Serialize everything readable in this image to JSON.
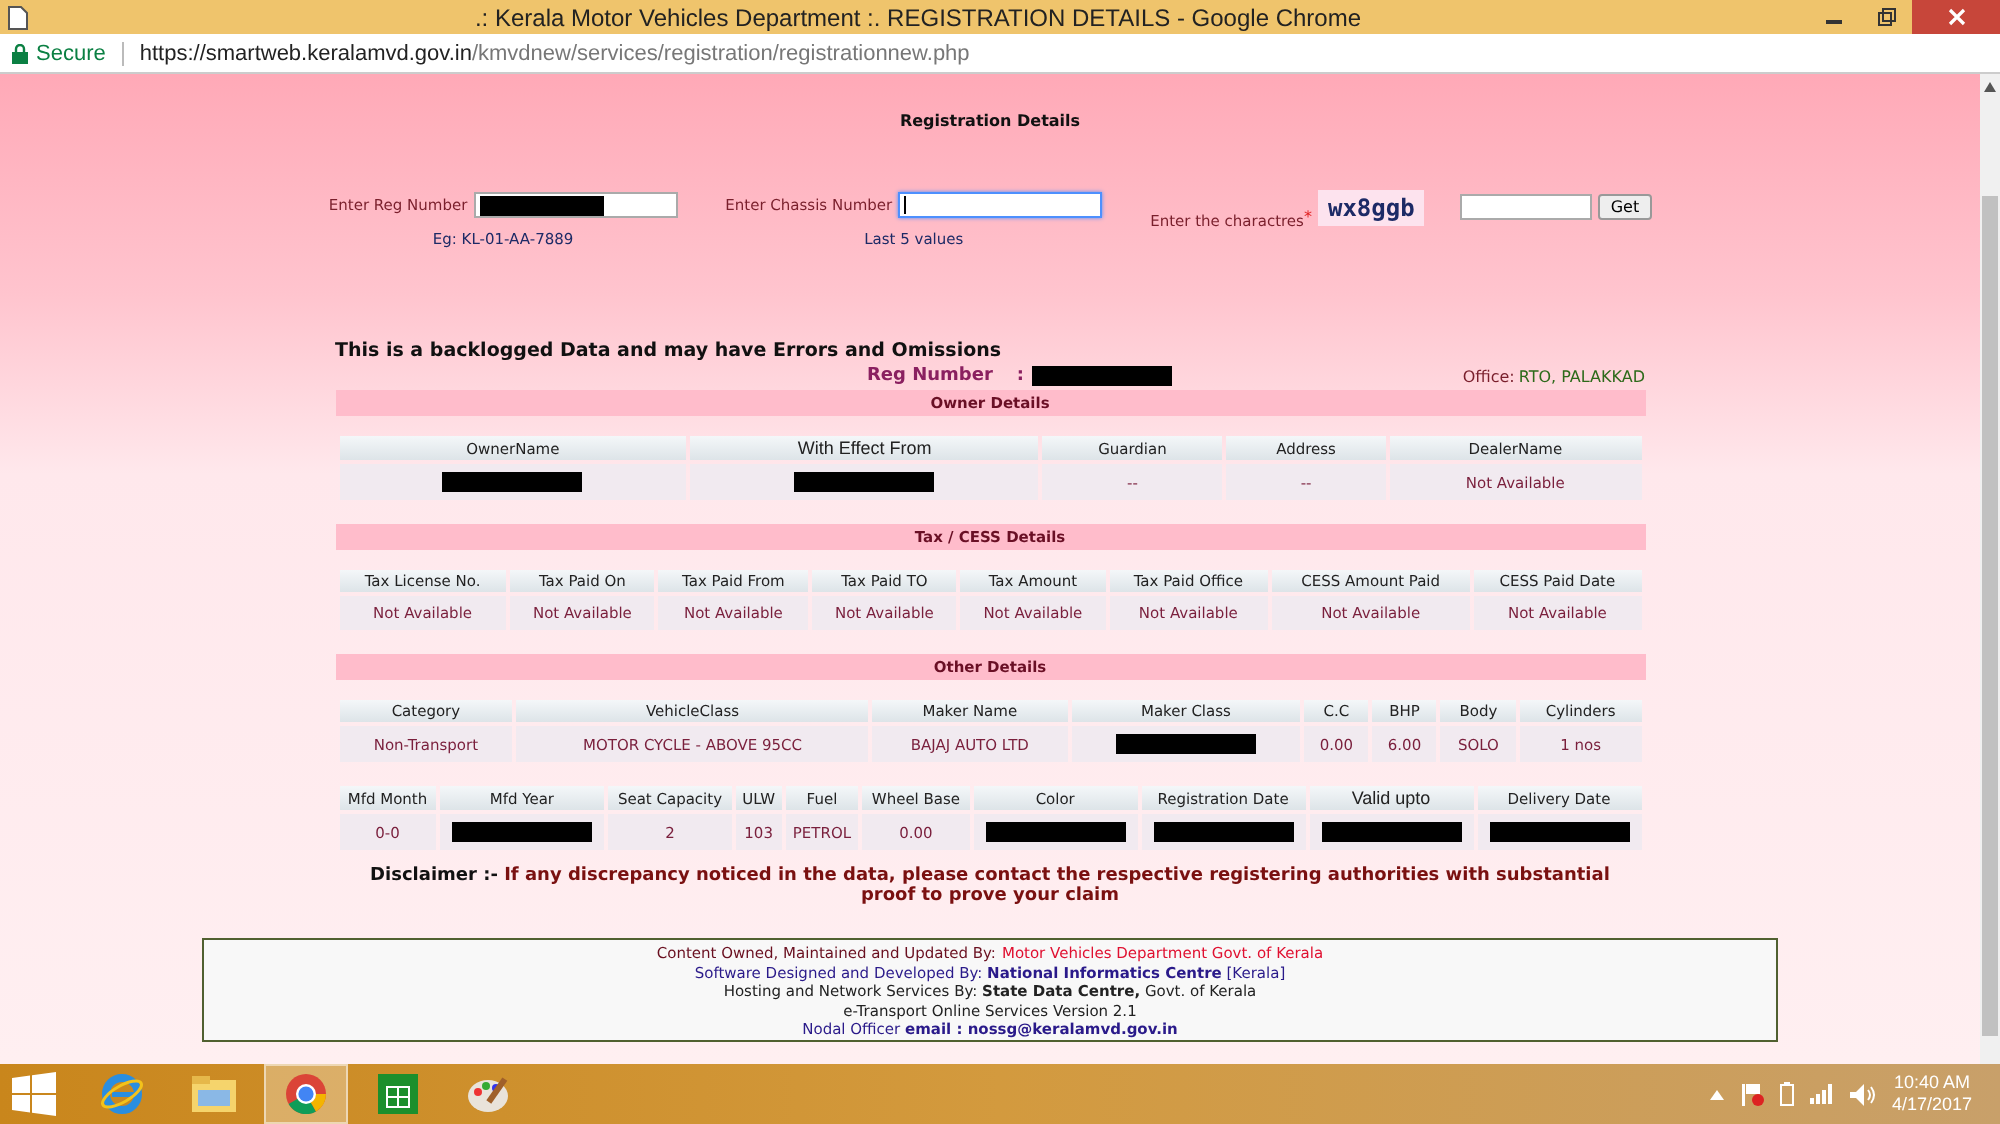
{
  "window": {
    "title": ".: Kerala Motor Vehicles Department :. REGISTRATION DETAILS - Google Chrome"
  },
  "address_bar": {
    "security": "Secure",
    "url_host": "https://smartweb.keralamvd.gov.in",
    "url_path": "/kmvdnew/services/registration/registrationnew.php"
  },
  "page": {
    "heading": "Registration Details",
    "form": {
      "reg_label": "Enter Reg Number",
      "reg_hint": "Eg: KL-01-AA-7889",
      "chassis_label": "Enter Chassis Number",
      "chassis_hint": "Last 5 values",
      "chassis_focused": true,
      "captcha_label": "Enter the charactres",
      "required_mark": "*",
      "captcha": "wx8ggb",
      "get_button": "Get"
    },
    "notice": "This is a backlogged Data and may have Errors and Omissions",
    "reg_number_label": "Reg Number",
    "reg_colon": ":",
    "office_label": "Office:",
    "office": "RTO, PALAKKAD",
    "sections": [
      {
        "title": "Owner Details",
        "tables": [
          {
            "columns": [
              {
                "label": "OwnerName",
                "kind": "normal"
              },
              {
                "label": "With Effect From",
                "kind": "large"
              },
              {
                "label": "Guardian",
                "kind": "normal"
              },
              {
                "label": "Address",
                "kind": "normal"
              },
              {
                "label": "DealerName",
                "kind": "normal"
              }
            ],
            "cells": [
              {
                "kind": "redacted"
              },
              {
                "kind": "redacted"
              },
              {
                "kind": "text",
                "text": "--"
              },
              {
                "kind": "text",
                "text": "--"
              },
              {
                "kind": "text",
                "text": "Not Available"
              }
            ]
          }
        ]
      },
      {
        "title": "Tax / CESS Details",
        "tables": [
          {
            "columns": [
              {
                "label": "Tax License No.",
                "kind": "normal"
              },
              {
                "label": "Tax Paid On",
                "kind": "normal"
              },
              {
                "label": "Tax Paid From",
                "kind": "normal"
              },
              {
                "label": "Tax Paid TO",
                "kind": "normal"
              },
              {
                "label": "Tax Amount",
                "kind": "normal"
              },
              {
                "label": "Tax Paid Office",
                "kind": "normal"
              },
              {
                "label": "CESS Amount Paid",
                "kind": "normal"
              },
              {
                "label": "CESS Paid Date",
                "kind": "normal"
              }
            ],
            "cells": [
              {
                "kind": "text",
                "text": "Not Available"
              },
              {
                "kind": "text",
                "text": "Not Available"
              },
              {
                "kind": "text",
                "text": "Not Available"
              },
              {
                "kind": "text",
                "text": "Not Available"
              },
              {
                "kind": "text",
                "text": "Not Available"
              },
              {
                "kind": "text",
                "text": "Not Available"
              },
              {
                "kind": "text",
                "text": "Not Available"
              },
              {
                "kind": "text",
                "text": "Not Available"
              }
            ]
          }
        ]
      },
      {
        "title": "Other Details",
        "tables": [
          {
            "columns": [
              {
                "label": "Category",
                "kind": "normal"
              },
              {
                "label": "VehicleClass",
                "kind": "normal"
              },
              {
                "label": "Maker Name",
                "kind": "normal"
              },
              {
                "label": "Maker Class",
                "kind": "normal"
              },
              {
                "label": "C.C",
                "kind": "normal"
              },
              {
                "label": "BHP",
                "kind": "normal"
              },
              {
                "label": "Body",
                "kind": "normal"
              },
              {
                "label": "Cylinders",
                "kind": "normal"
              }
            ],
            "cells": [
              {
                "kind": "text",
                "text": "Non-Transport"
              },
              {
                "kind": "text",
                "text": "MOTOR CYCLE - ABOVE 95CC"
              },
              {
                "kind": "text",
                "text": "BAJAJ AUTO LTD"
              },
              {
                "kind": "redacted"
              },
              {
                "kind": "text",
                "text": "0.00"
              },
              {
                "kind": "text",
                "text": "6.00"
              },
              {
                "kind": "text",
                "text": "SOLO"
              },
              {
                "kind": "text",
                "text": "1 nos"
              }
            ]
          },
          {
            "columns": [
              {
                "label": "Mfd Month",
                "kind": "normal"
              },
              {
                "label": "Mfd Year",
                "kind": "normal"
              },
              {
                "label": "Seat Capacity",
                "kind": "normal"
              },
              {
                "label": "ULW",
                "kind": "normal"
              },
              {
                "label": "Fuel",
                "kind": "normal"
              },
              {
                "label": "Wheel Base",
                "kind": "normal"
              },
              {
                "label": "Color",
                "kind": "normal"
              },
              {
                "label": "Registration Date",
                "kind": "normal"
              },
              {
                "label": "Valid upto",
                "kind": "large"
              },
              {
                "label": "Delivery Date",
                "kind": "normal"
              }
            ],
            "cells": [
              {
                "kind": "text",
                "text": "0-0"
              },
              {
                "kind": "redacted"
              },
              {
                "kind": "text",
                "text": "2"
              },
              {
                "kind": "text",
                "text": "103"
              },
              {
                "kind": "text",
                "text": "PETROL"
              },
              {
                "kind": "text",
                "text": "0.00"
              },
              {
                "kind": "redacted"
              },
              {
                "kind": "redacted"
              },
              {
                "kind": "redacted"
              },
              {
                "kind": "redacted"
              }
            ]
          }
        ]
      }
    ],
    "disclaimer_label": "Disclaimer :-",
    "disclaimer": "If any discrepancy noticed in the data, please contact the respective registering authorities with substantial proof to prove your claim",
    "footer": [
      {
        "kind": "owned",
        "text": "Content Owned, Maintained and Updated By:",
        "link": "Motor Vehicles Department Govt. of Kerala"
      },
      {
        "kind": "nic",
        "text": "Software Designed and Developed By: **National Informatics Centre** [Kerala]"
      },
      {
        "kind": "plain",
        "text": "Hosting and Network Services By: **State Data Centre,** Govt. of Kerala"
      },
      {
        "kind": "plain",
        "text": "e-Transport Online Services Version 2.1"
      },
      {
        "kind": "nic",
        "text": "Nodal Officer  **email : nossg@keralamvd.gov.in**"
      }
    ]
  },
  "taskbar": {
    "apps": [
      {
        "kind": "ie",
        "selected": false
      },
      {
        "kind": "explorer",
        "selected": false
      },
      {
        "kind": "chrome",
        "selected": true
      },
      {
        "kind": "store",
        "selected": false
      },
      {
        "kind": "paint",
        "selected": false
      }
    ],
    "time": "10:40 AM",
    "date": "4/17/2017"
  }
}
